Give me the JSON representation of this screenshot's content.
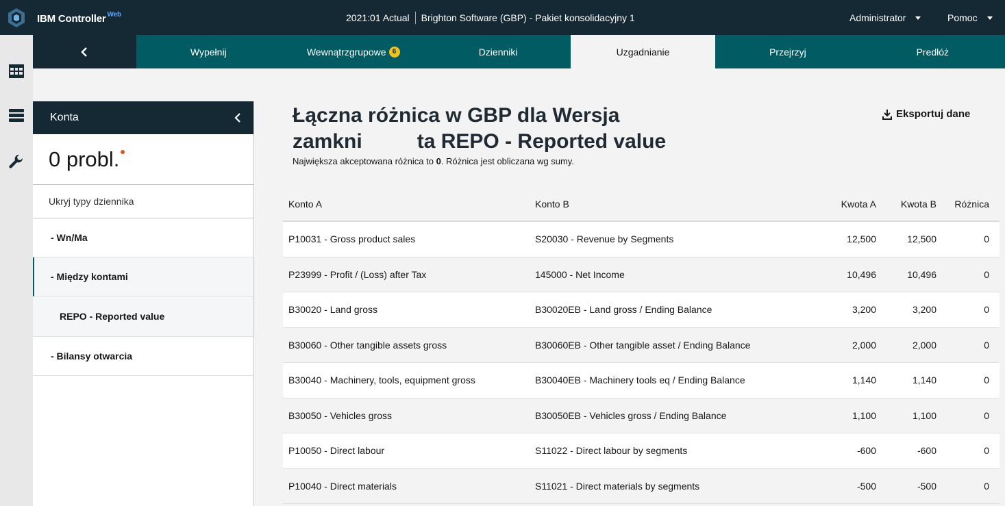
{
  "header": {
    "app_name": "IBM Controller",
    "app_suffix": "Web",
    "period": "2021:01 Actual",
    "company": "Brighton Software (GBP) - Pakiet konsolidacyjny 1",
    "user_menu": "Administrator",
    "help_menu": "Pomoc"
  },
  "rail": {
    "icons": [
      "grid-icon",
      "server-icon",
      "wrench-icon"
    ]
  },
  "tabs": [
    {
      "label": "Wypełnij",
      "active": false
    },
    {
      "label": "Wewnątrzgrupowe",
      "badge": "6",
      "active": false
    },
    {
      "label": "Dzienniki",
      "active": false
    },
    {
      "label": "Uzgadnianie",
      "active": true
    },
    {
      "label": "Przejrzyj",
      "active": false
    },
    {
      "label": "Predłóż",
      "active": false
    }
  ],
  "sidebar": {
    "title": "Konta",
    "issues": "0 probl.",
    "hide_types": "Ukryj typy dziennika",
    "items": [
      {
        "label": "- Wn/Ma"
      },
      {
        "label": "- Między kontami"
      },
      {
        "label": "REPO - Reported value"
      },
      {
        "label": "- Bilansy otwarcia"
      }
    ]
  },
  "main": {
    "title_line1": "Łączna różnica w GBP dla Wersja",
    "title_line2_start": "zamkni",
    "title_line2_end": "ta REPO - Reported value",
    "subtitle_pre": "Największa akceptowana różnica to ",
    "subtitle_value": "0",
    "subtitle_post": ". Różnica jest obliczana wg sumy.",
    "export_label": "Eksportuj dane"
  },
  "table": {
    "columns": [
      "Konto A",
      "Konto B",
      "Kwota A",
      "Kwota B",
      "Różnica"
    ],
    "rows": [
      [
        "P10031 - Gross product sales",
        "S20030 - Revenue by Segments",
        "12,500",
        "12,500",
        "0"
      ],
      [
        "P23999 - Profit / (Loss) after Tax",
        "145000 - Net Income",
        "10,496",
        "10,496",
        "0"
      ],
      [
        "B30020 - Land gross",
        "B30020EB - Land gross / Ending Balance",
        "3,200",
        "3,200",
        "0"
      ],
      [
        "B30060 - Other tangible assets gross",
        "B30060EB - Other tangible asset / Ending Balance",
        "2,000",
        "2,000",
        "0"
      ],
      [
        "B30040 - Machinery, tools, equipment gross",
        "B30040EB - Machinery tools eq / Ending Balance",
        "1,140",
        "1,140",
        "0"
      ],
      [
        "B30050 - Vehicles gross",
        "B30050EB - Vehicles gross / Ending Balance",
        "1,100",
        "1,100",
        "0"
      ],
      [
        "P10050 - Direct labour",
        "S11022 - Direct labour by segments",
        "-600",
        "-600",
        "0"
      ],
      [
        "P10040 - Direct materials",
        "S11021 - Direct materials by segments",
        "-500",
        "-500",
        "0"
      ]
    ]
  }
}
